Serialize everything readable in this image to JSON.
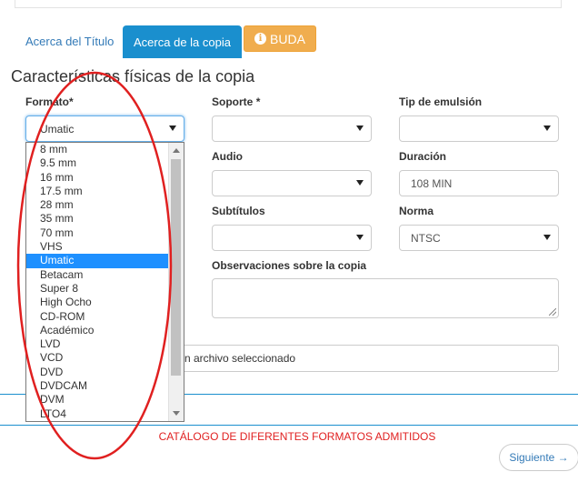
{
  "tabs": {
    "title_tab": "Acerca del Título",
    "copy_tab": "Acerca de la copia",
    "buda_button": "BUDA"
  },
  "section_title": "Características físicas de la copia",
  "fields": {
    "formato": {
      "label": "Formato",
      "required": "*",
      "value": "Umatic"
    },
    "soporte": {
      "label": "Soporte",
      "required": "*",
      "value": ""
    },
    "emulsion": {
      "label": "Tip de emulsión",
      "value": ""
    },
    "audio": {
      "label": "Audio",
      "value": ""
    },
    "duracion": {
      "label": "Duración",
      "value": "108 MIN"
    },
    "subtitulos": {
      "label": "Subtítulos",
      "value": ""
    },
    "norma": {
      "label": "Norma",
      "value": "NTSC"
    },
    "observaciones": {
      "label": "Observaciones sobre la copia",
      "value": ""
    }
  },
  "file_input": {
    "status": "n archivo seleccionado"
  },
  "format_options": [
    "8 mm",
    "9.5 mm",
    "16 mm",
    "17.5 mm",
    "28 mm",
    "35 mm",
    "70 mm",
    "VHS",
    "Umatic",
    "Betacam",
    "Super 8",
    "High Ocho",
    "CD-ROM",
    "Académico",
    "LVD",
    "VCD",
    "DVD",
    "DVDCAM",
    "DVM",
    "LTO4"
  ],
  "selected_format": "Umatic",
  "annotation_text": "CATÁLOGO DE DIFERENTES FORMATOS ADMITIDOS",
  "next_button": "Siguiente →",
  "colors": {
    "primary": "#1a8fce",
    "warning": "#f0ad4e",
    "annotation": "#e02020",
    "selected_option": "#1e90ff"
  }
}
